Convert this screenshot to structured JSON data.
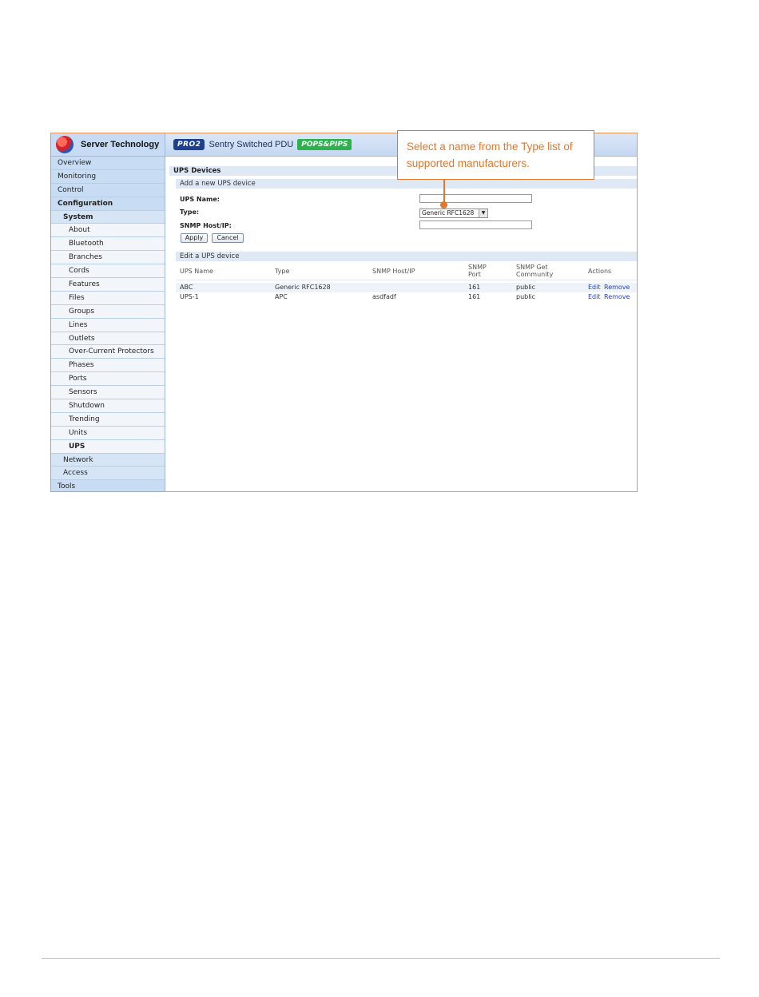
{
  "brand": {
    "name": "Server Technology",
    "product_badge": "PRO2",
    "product_name": "Sentry Switched PDU",
    "pops_badge": "POPS&PIPS"
  },
  "sidebar": {
    "items": [
      {
        "label": "Overview",
        "level": 0
      },
      {
        "label": "Monitoring",
        "level": 0
      },
      {
        "label": "Control",
        "level": 0
      },
      {
        "label": "Configuration",
        "level": 0
      },
      {
        "label": "System",
        "level": 1
      },
      {
        "label": "About",
        "level": 2
      },
      {
        "label": "Bluetooth",
        "level": 2
      },
      {
        "label": "Branches",
        "level": 2
      },
      {
        "label": "Cords",
        "level": 2
      },
      {
        "label": "Features",
        "level": 2
      },
      {
        "label": "Files",
        "level": 2
      },
      {
        "label": "Groups",
        "level": 2
      },
      {
        "label": "Lines",
        "level": 2
      },
      {
        "label": "Outlets",
        "level": 2
      },
      {
        "label": "Over-Current Protectors",
        "level": 2
      },
      {
        "label": "Phases",
        "level": 2
      },
      {
        "label": "Ports",
        "level": 2
      },
      {
        "label": "Sensors",
        "level": 2
      },
      {
        "label": "Shutdown",
        "level": 2
      },
      {
        "label": "Trending",
        "level": 2
      },
      {
        "label": "Units",
        "level": 2
      },
      {
        "label": "UPS",
        "level": 2
      },
      {
        "label": "Network",
        "level": 1
      },
      {
        "label": "Access",
        "level": 1
      },
      {
        "label": "Tools",
        "level": 0
      }
    ]
  },
  "main": {
    "section_title": "UPS Devices",
    "add_title": "Add a new UPS device",
    "form": {
      "name_label": "UPS Name:",
      "name_value": "",
      "type_label": "Type:",
      "type_value": "Generic RFC1628",
      "host_label": "SNMP Host/IP:",
      "host_value": ""
    },
    "buttons": {
      "apply": "Apply",
      "cancel": "Cancel"
    },
    "edit_title": "Edit a UPS device",
    "table": {
      "headers": [
        "UPS Name",
        "Type",
        "SNMP Host/IP",
        "SNMP Port",
        "SNMP Get Community",
        "Actions"
      ],
      "rows": [
        {
          "name": "ABC",
          "type": "Generic RFC1628",
          "host": "",
          "port": "161",
          "community": "public",
          "edit": "Edit",
          "remove": "Remove"
        },
        {
          "name": "UPS-1",
          "type": "APC",
          "host": "asdfadf",
          "port": "161",
          "community": "public",
          "edit": "Edit",
          "remove": "Remove"
        }
      ]
    }
  },
  "callout": {
    "text": "Select a name from the Type list of supported manufacturers."
  },
  "colors": {
    "accent": "#e0772d",
    "sidebar": "#cfe0f5",
    "link": "#1f3fcf"
  }
}
